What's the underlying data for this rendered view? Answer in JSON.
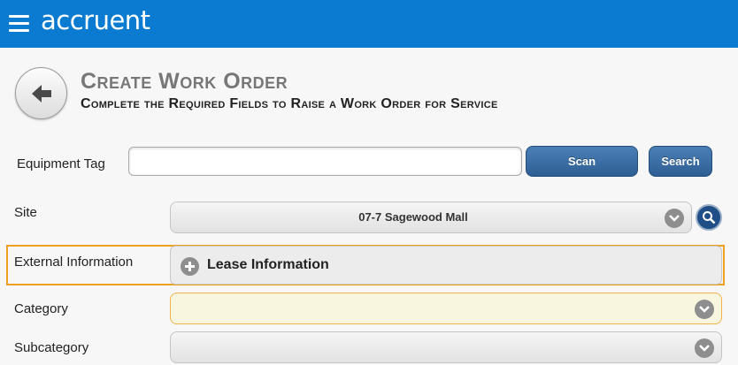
{
  "header": {
    "brand": "accruent",
    "brand_color": "#0a7bd1",
    "menu_icon": "hamburger-icon"
  },
  "page": {
    "back_icon": "arrow-left-icon",
    "title": "Create Work Order",
    "subtitle": "Complete the Required Fields to Raise a Work Order for Service"
  },
  "equipment": {
    "label": "Equipment Tag",
    "value": "",
    "scan_label": "Scan",
    "search_label": "Search"
  },
  "site": {
    "label": "Site",
    "value": "07-7 Sagewood Mall",
    "search_icon": "magnifier-icon"
  },
  "external": {
    "label": "External Information",
    "lease_label": "Lease Information",
    "expand_icon": "plus-circle-icon",
    "highlight_color": "#f0a020"
  },
  "category": {
    "label": "Category",
    "value": ""
  },
  "subcategory": {
    "label": "Subcategory",
    "value": ""
  }
}
